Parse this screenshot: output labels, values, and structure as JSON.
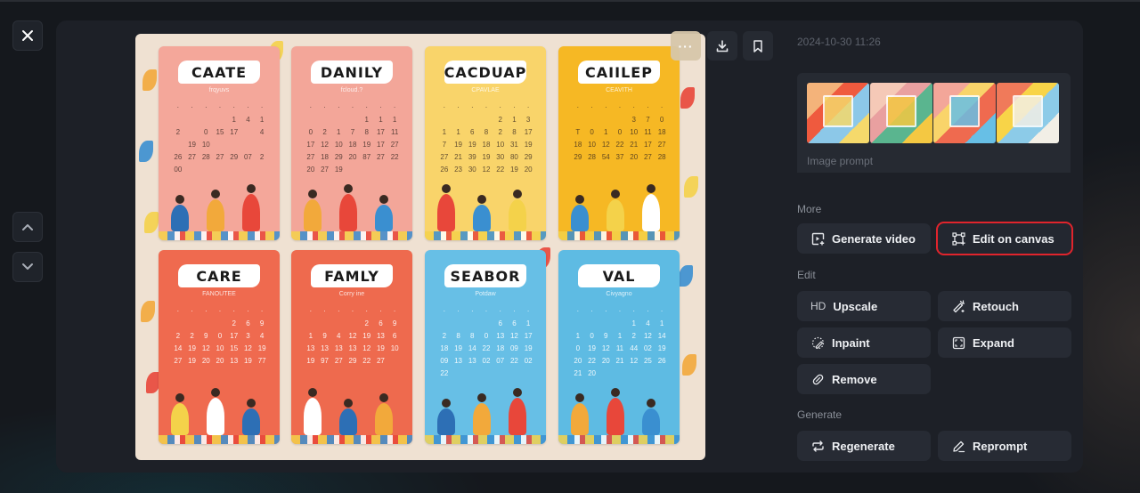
{
  "window": {
    "close_icon": "close-icon",
    "nav_up_icon": "chevron-up-icon",
    "nav_down_icon": "chevron-down-icon"
  },
  "image": {
    "description": "Generated image: grid of eight illustrated family calendar cards",
    "cards": [
      {
        "title": "CAATE",
        "subtitle": "frqyuvs",
        "color": "#f4a79a",
        "days": [
          "1",
          "4",
          "1",
          "2",
          "",
          "0",
          "15",
          "17",
          "",
          "4",
          "",
          "19",
          "10",
          "",
          "",
          "",
          "",
          "26",
          "27",
          "28",
          "27",
          "29",
          "07",
          "2",
          "00"
        ]
      },
      {
        "title": "DANILY",
        "subtitle": "fcloud.?",
        "color": "#f3a699",
        "days": [
          "1",
          "1",
          "1",
          "0",
          "2",
          "1",
          "7",
          "8",
          "17",
          "11",
          "17",
          "12",
          "10",
          "18",
          "19",
          "17",
          "27",
          "27",
          "18",
          "29",
          "20",
          "87",
          "27",
          "22",
          "20",
          "27",
          "19"
        ]
      },
      {
        "title": "CACDUAP",
        "subtitle": "CPAVLAE",
        "color": "#f9d46a",
        "days": [
          "2",
          "1",
          "3",
          "1",
          "1",
          "6",
          "8",
          "2",
          "8",
          "17",
          "7",
          "19",
          "19",
          "18",
          "10",
          "31",
          "19",
          "27",
          "21",
          "39",
          "19",
          "30",
          "80",
          "29",
          "26",
          "23",
          "30",
          "12",
          "22",
          "19",
          "20"
        ]
      },
      {
        "title": "CAIILEP",
        "subtitle": "CEAVITH",
        "color": "#f6b824",
        "days": [
          "3",
          "7",
          "0",
          "T",
          "0",
          "1",
          "0",
          "10",
          "11",
          "18",
          "18",
          "10",
          "12",
          "22",
          "21",
          "17",
          "27",
          "29",
          "28",
          "54",
          "37",
          "20",
          "27",
          "28"
        ]
      },
      {
        "title": "CARE",
        "subtitle": "FANOUTEE",
        "color": "#ef6a4f",
        "days": [
          "2",
          "6",
          "9",
          "2",
          "2",
          "9",
          "0",
          "17",
          "3",
          "4",
          "14",
          "19",
          "12",
          "10",
          "15",
          "12",
          "19",
          "27",
          "19",
          "20",
          "20",
          "13",
          "19",
          "77"
        ]
      },
      {
        "title": "FAMLY",
        "subtitle": "Corry ine",
        "color": "#ee6a4e",
        "days": [
          "2",
          "6",
          "9",
          "1",
          "9",
          "4",
          "12",
          "19",
          "13",
          "6",
          "13",
          "13",
          "13",
          "13",
          "12",
          "19",
          "10",
          "19",
          "97",
          "27",
          "29",
          "22",
          "27"
        ]
      },
      {
        "title": "SEABOR",
        "subtitle": "Potdaw",
        "color": "#67bfe6",
        "days": [
          "6",
          "6",
          "1",
          "2",
          "8",
          "8",
          "0",
          "13",
          "12",
          "17",
          "18",
          "19",
          "14",
          "22",
          "18",
          "09",
          "19",
          "09",
          "13",
          "13",
          "02",
          "07",
          "22",
          "02",
          "22"
        ]
      },
      {
        "title": "VAL",
        "subtitle": "Civyagno",
        "color": "#5ebbe3",
        "days": [
          "1",
          "4",
          "1",
          "1",
          "0",
          "9",
          "1",
          "2",
          "12",
          "14",
          "0",
          "19",
          "12",
          "11",
          "44",
          "02",
          "19",
          "20",
          "22",
          "20",
          "21",
          "12",
          "25",
          "26",
          "21",
          "20"
        ]
      }
    ]
  },
  "image_toolbar": {
    "more_label": "···",
    "download_icon": "download-icon",
    "bookmark_icon": "bookmark-icon"
  },
  "panel": {
    "timestamp": "2024-10-30 11:26",
    "prompt_label": "Image prompt",
    "thumbnails": [
      {
        "name": "thumbnail-1",
        "palette": [
          "#f4b37a",
          "#ef5a3e",
          "#8cc8e8",
          "#f5d96b"
        ]
      },
      {
        "name": "thumbnail-2",
        "palette": [
          "#f5c9b7",
          "#e9a0a0",
          "#5ab58f",
          "#f4c842"
        ]
      },
      {
        "name": "thumbnail-3",
        "palette": [
          "#f3a699",
          "#f9d46a",
          "#ef6a4f",
          "#67bfe6"
        ]
      },
      {
        "name": "thumbnail-4",
        "palette": [
          "#f07a5a",
          "#f8d448",
          "#8ccbe8",
          "#f2efe6"
        ]
      }
    ],
    "sections": {
      "more": {
        "label": "More",
        "buttons": [
          {
            "label": "Generate video",
            "icon": "video-plus-icon"
          },
          {
            "label": "Edit on canvas",
            "icon": "canvas-edit-icon",
            "highlighted": true
          }
        ]
      },
      "edit": {
        "label": "Edit",
        "buttons": [
          {
            "label": "Upscale",
            "icon": "hd-icon",
            "icon_text": "HD"
          },
          {
            "label": "Retouch",
            "icon": "magic-wand-icon"
          },
          {
            "label": "Inpaint",
            "icon": "inpaint-brush-icon"
          },
          {
            "label": "Expand",
            "icon": "expand-icon"
          },
          {
            "label": "Remove",
            "icon": "eraser-icon"
          }
        ]
      },
      "generate": {
        "label": "Generate",
        "buttons": [
          {
            "label": "Regenerate",
            "icon": "regenerate-icon"
          },
          {
            "label": "Reprompt",
            "icon": "pencil-icon"
          }
        ]
      }
    }
  },
  "colors": {
    "highlight_outline": "#e0242c",
    "panel_bg": "#1d2027",
    "button_bg": "#272b34",
    "image_bg": "#efe1d2"
  }
}
